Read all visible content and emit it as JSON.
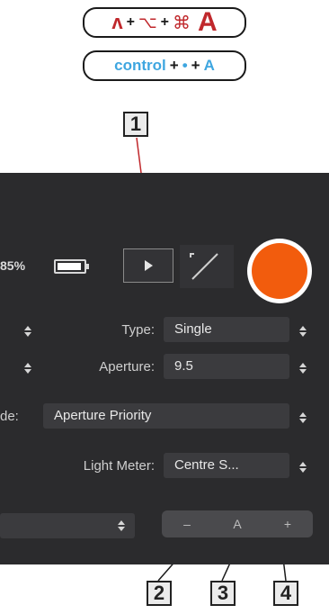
{
  "shortcuts": {
    "mac": {
      "key1": "ʌ",
      "plus1": "+",
      "key2": "⌥",
      "plus2": "+",
      "key3": "⌘",
      "key4": "A"
    },
    "pc": {
      "key1": "control",
      "plus1": "+",
      "key2": "•",
      "plus2": "+",
      "key3": "A"
    }
  },
  "callouts": [
    "1",
    "2",
    "3",
    "4"
  ],
  "status": {
    "battery_text": "85%",
    "battery_level": 0.85
  },
  "toolbar": {
    "play_icon": "play-icon",
    "expand_icon": "expand-diagonal-icon",
    "record_color": "#f25c0d"
  },
  "settings": {
    "type": {
      "label": "Type:",
      "value": "Single"
    },
    "aperture": {
      "label": "Aperture:",
      "value": "9.5"
    },
    "mode": {
      "label": "de:",
      "value": "Aperture Priority"
    },
    "light_meter": {
      "label": "Light Meter:",
      "value": "Centre S..."
    }
  },
  "exposure": {
    "minus": "–",
    "auto": "A",
    "plus": "+"
  }
}
